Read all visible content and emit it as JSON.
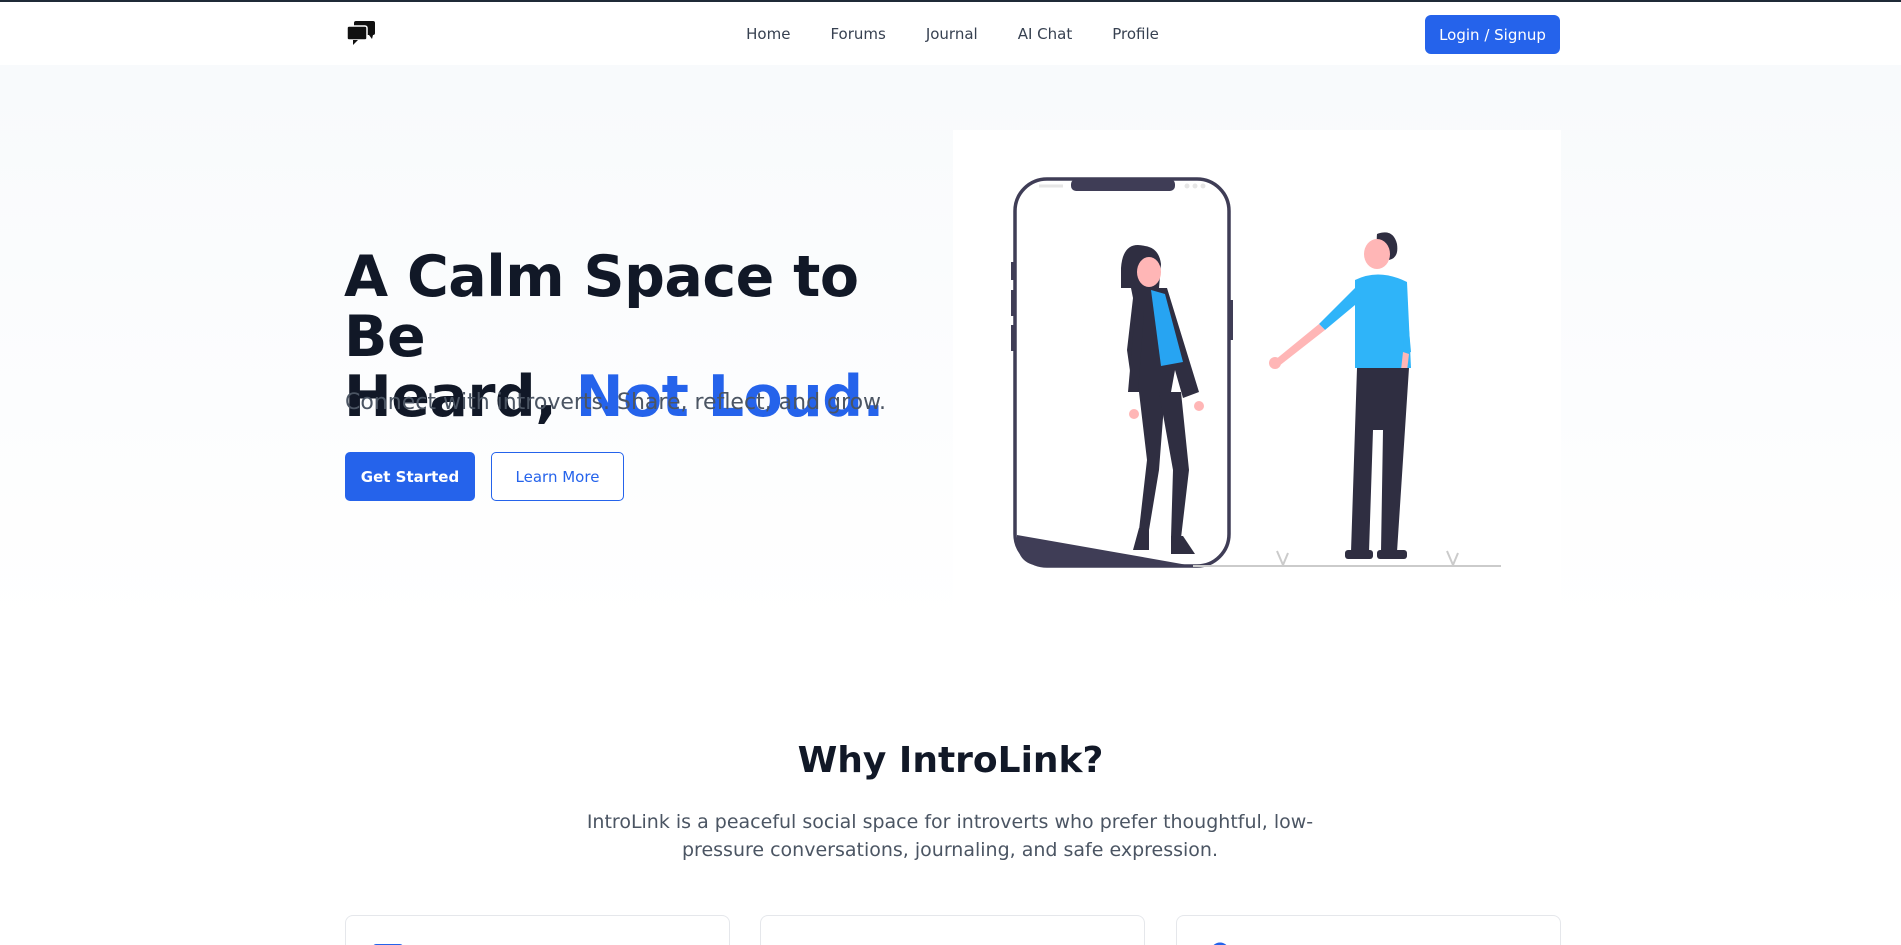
{
  "nav": {
    "logo_icon": "chat-bubbles-icon",
    "links": [
      "Home",
      "Forums",
      "Journal",
      "AI Chat",
      "Profile"
    ],
    "login_label": "Login / Signup"
  },
  "hero": {
    "title_line1": "A Calm Space to Be",
    "title_line2_prefix": "Heard, ",
    "title_line2_accent": "Not Loud.",
    "subtitle": "Connect with introverts. Share, reflect, and grow.",
    "primary_button": "Get Started",
    "secondary_button": "Learn More",
    "illustration": "two-people-phone-illustration"
  },
  "why": {
    "title": "Why IntroLink?",
    "description": "IntroLink is a peaceful social space for introverts who prefer thoughtful, low-pressure conversations, journaling, and safe expression.",
    "cards": [
      {
        "icon": "square-icon"
      },
      {
        "icon": "chat-icon"
      },
      {
        "icon": "pin-icon"
      }
    ]
  },
  "colors": {
    "accent": "#2563eb",
    "text_dark": "#111827",
    "text_muted": "#4b5563"
  }
}
